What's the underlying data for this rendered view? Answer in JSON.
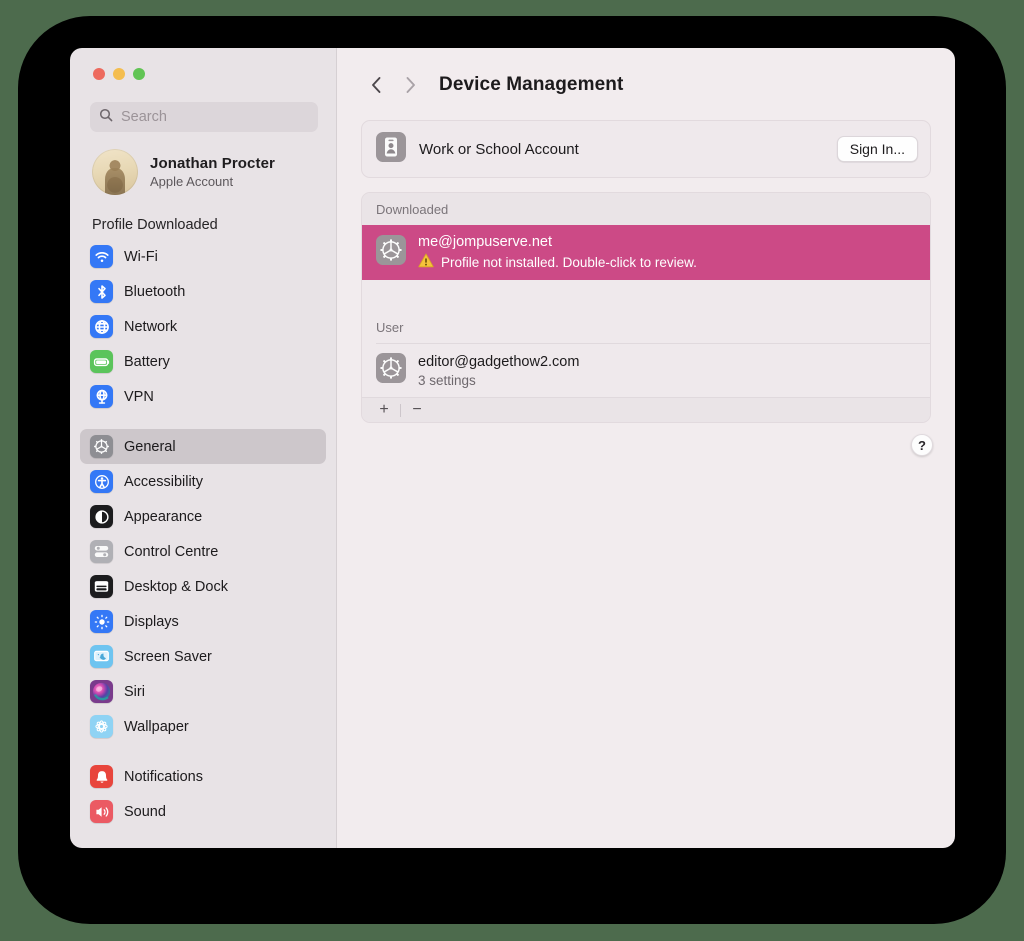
{
  "window": {
    "traffic_lights": [
      "close",
      "minimize",
      "zoom"
    ]
  },
  "sidebar": {
    "search": {
      "placeholder": "Search",
      "value": ""
    },
    "account": {
      "name": "Jonathan Procter",
      "subtitle": "Apple Account"
    },
    "status_note": "Profile Downloaded",
    "items": [
      {
        "label": "Wi-Fi",
        "icon": "wifi-icon",
        "color": "#3478f6",
        "selected": false
      },
      {
        "label": "Bluetooth",
        "icon": "bluetooth-icon",
        "color": "#3478f6",
        "selected": false
      },
      {
        "label": "Network",
        "icon": "network-globe-icon",
        "color": "#3478f6",
        "selected": false
      },
      {
        "label": "Battery",
        "icon": "battery-icon",
        "color": "#5bc45b",
        "selected": false
      },
      {
        "label": "VPN",
        "icon": "vpn-icon",
        "color": "#3478f6",
        "selected": false
      },
      {
        "label": "General",
        "icon": "gear-icon",
        "color": "#8e8e93",
        "selected": true,
        "group_start": true
      },
      {
        "label": "Accessibility",
        "icon": "accessibility-icon",
        "color": "#3478f6",
        "selected": false
      },
      {
        "label": "Appearance",
        "icon": "appearance-icon",
        "color": "#1c1c1e",
        "selected": false
      },
      {
        "label": "Control Centre",
        "icon": "control-centre-icon",
        "color": "#b0b0b5",
        "selected": false
      },
      {
        "label": "Desktop & Dock",
        "icon": "desktop-dock-icon",
        "color": "#1c1c1e",
        "selected": false
      },
      {
        "label": "Displays",
        "icon": "displays-icon",
        "color": "#3478f6",
        "selected": false
      },
      {
        "label": "Screen Saver",
        "icon": "screen-saver-icon",
        "color": "#6ec4f0",
        "selected": false
      },
      {
        "label": "Siri",
        "icon": "siri-icon",
        "color": "#7a3b8c",
        "selected": false
      },
      {
        "label": "Wallpaper",
        "icon": "wallpaper-icon",
        "color": "#8fd3f4",
        "selected": false
      },
      {
        "label": "Notifications",
        "icon": "notifications-icon",
        "color": "#e8453c",
        "selected": false,
        "group_start": true
      },
      {
        "label": "Sound",
        "icon": "sound-icon",
        "color": "#eb5a63",
        "selected": false,
        "clipped": true
      }
    ]
  },
  "main": {
    "back_icon": "chevron-left-icon",
    "forward_icon": "chevron-right-icon",
    "title": "Device Management",
    "work_account": {
      "icon": "id-card-icon",
      "label": "Work or School Account",
      "button_label": "Sign In..."
    },
    "groups": [
      {
        "header": "Downloaded",
        "rows": [
          {
            "icon": "profile-gear-icon",
            "title": "me@jompuserve.net",
            "subtitle": "Profile not installed. Double-click to review.",
            "warning_icon": "warning-triangle-icon",
            "selected": true
          }
        ]
      },
      {
        "header": "User",
        "rows": [
          {
            "icon": "profile-gear-icon",
            "title": "editor@gadgethow2.com",
            "subtitle": "3 settings",
            "selected": false
          }
        ]
      }
    ],
    "footer": {
      "add_label": "+",
      "remove_label": "−"
    },
    "help_label": "?"
  },
  "colors": {
    "selection_pink": "#cc4a86",
    "window_bg": "#f2ecee",
    "sidebar_bg": "#e8e3e6",
    "warning_yellow": "#f5c33b"
  }
}
